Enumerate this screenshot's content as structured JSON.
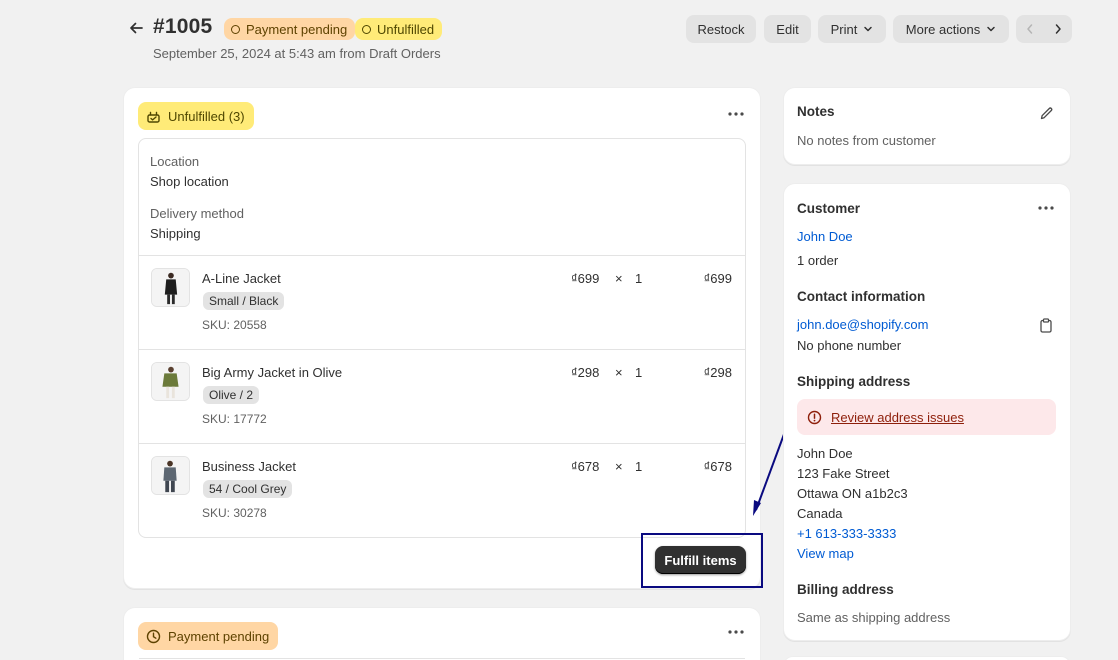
{
  "header": {
    "order_number": "#1005",
    "badges": {
      "payment": "Payment pending",
      "fulfillment": "Unfulfilled"
    },
    "subtitle": "September 25, 2024 at 5:43 am from Draft Orders",
    "actions": {
      "restock": "Restock",
      "edit": "Edit",
      "print": "Print",
      "more": "More actions"
    }
  },
  "fulfillment_card": {
    "badge": "Unfulfilled (3)",
    "location_label": "Location",
    "location_value": "Shop location",
    "delivery_label": "Delivery method",
    "delivery_value": "Shipping",
    "items": [
      {
        "name": "A-Line Jacket",
        "variant": "Small / Black",
        "sku": "SKU: 20558",
        "price": "₫699",
        "times": "×",
        "qty": "1",
        "total": "₫699"
      },
      {
        "name": "Big Army Jacket in Olive",
        "variant": "Olive / 2",
        "sku": "SKU: 17772",
        "price": "₫298",
        "times": "×",
        "qty": "1",
        "total": "₫298"
      },
      {
        "name": "Business Jacket",
        "variant": "54 / Cool Grey",
        "sku": "SKU: 30278",
        "price": "₫678",
        "times": "×",
        "qty": "1",
        "total": "₫678"
      }
    ],
    "fulfill_button": "Fulfill items"
  },
  "payment_card": {
    "badge": "Payment pending"
  },
  "notes": {
    "title": "Notes",
    "text": "No notes from customer"
  },
  "customer": {
    "title": "Customer",
    "name": "John Doe",
    "orders": "1 order",
    "contact_title": "Contact information",
    "email": "john.doe@shopify.com",
    "phone": "No phone number",
    "shipping_title": "Shipping address",
    "review_link": "Review address issues",
    "address": [
      "John Doe",
      "123 Fake Street",
      "Ottawa ON a1b2c3",
      "Canada"
    ],
    "address_phone": "+1 613-333-3333",
    "view_map": "View map",
    "billing_title": "Billing address",
    "billing_text": "Same as shipping address"
  },
  "colors": {
    "accent": "#005bd3",
    "annotation": "#0a0a80",
    "payment_badge": "#ffd6a4",
    "unfulfilled_badge": "#ffeb78",
    "critical_bg": "#fde8ea"
  },
  "icons": [
    "arrow-left-icon",
    "chevron-down-icon",
    "chevron-left-icon",
    "chevron-right-icon",
    "fulfillment-icon",
    "ellipsis-icon",
    "clock-icon",
    "pencil-icon",
    "clipboard-icon",
    "alert-circle-icon"
  ]
}
